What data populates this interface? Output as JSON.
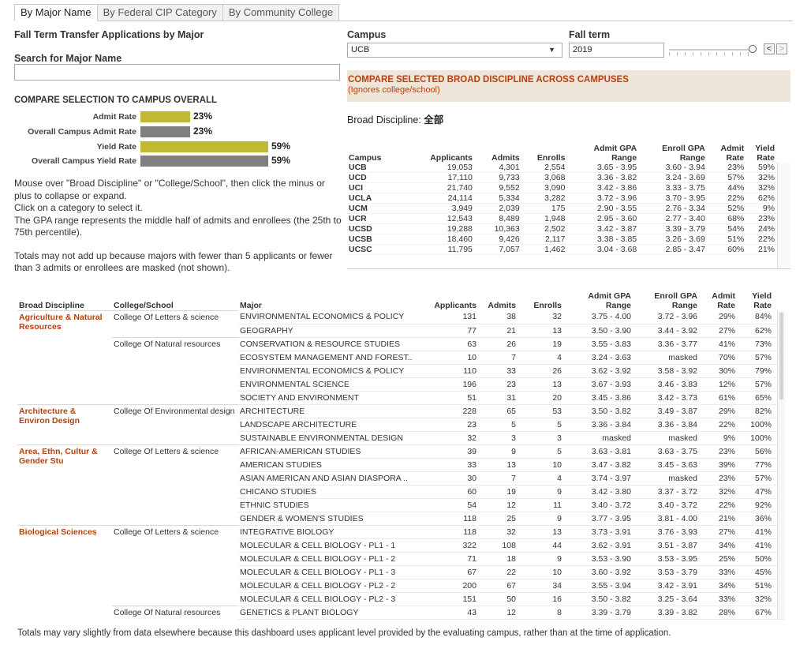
{
  "tabs": [
    "By Major Name",
    "By Federal CIP Category",
    "By Community College"
  ],
  "left": {
    "title": "Fall Term Transfer Applications by Major",
    "search_label": "Search for Major Name",
    "search_value": "",
    "compare_title": "COMPARE SELECTION TO CAMPUS OVERALL",
    "bars": [
      {
        "label": "Admit Rate",
        "value": "23%",
        "fraction": 0.23,
        "color": "#c2b933"
      },
      {
        "label": "Overall Campus Admit Rate",
        "value": "23%",
        "fraction": 0.23,
        "color": "#7f7f7f"
      },
      {
        "label": "Yield Rate",
        "value": "59%",
        "fraction": 0.59,
        "color": "#c2b933"
      },
      {
        "label": "Overall Campus Yield Rate",
        "value": "59%",
        "fraction": 0.59,
        "color": "#7f7f7f"
      }
    ],
    "notes": [
      "Mouse over \"Broad Discipline\" or \"College/School\", then click the minus or plus to collapse or expand.",
      "Click on a category to select it.",
      "The GPA range represents the middle half of admits and enrollees (the 25th to 75th percentile).",
      "Totals may not add up because majors with fewer than 5 applicants or fewer than 3 admits or enrollees are masked (not shown)."
    ]
  },
  "filters": {
    "campus_label": "Campus",
    "campus_value": "UCB",
    "term_label": "Fall term",
    "term_value": "2019",
    "prev_label": "<",
    "next_label": ">"
  },
  "compare_banner": {
    "title": "COMPARE SELECTED BROAD DISCIPLINE ACROSS CAMPUSES",
    "subtitle": "(Ignores college/school)"
  },
  "broad_discipline": {
    "label": "Broad Discipline:",
    "value": "全部"
  },
  "campus_table": {
    "headers": [
      "Campus",
      "Applicants",
      "Admits",
      "Enrolls",
      "Admit GPA Range",
      "Enroll GPA Range",
      "Admit Rate",
      "Yield Rate"
    ],
    "rows": [
      [
        "UCB",
        "19,053",
        "4,301",
        "2,554",
        "3.65 - 3.95",
        "3.60 - 3.94",
        "23%",
        "59%"
      ],
      [
        "UCD",
        "17,110",
        "9,733",
        "3,068",
        "3.36 - 3.82",
        "3.24 - 3.69",
        "57%",
        "32%"
      ],
      [
        "UCI",
        "21,740",
        "9,552",
        "3,090",
        "3.42 - 3.86",
        "3.33 - 3.75",
        "44%",
        "32%"
      ],
      [
        "UCLA",
        "24,114",
        "5,334",
        "3,282",
        "3.72 - 3.96",
        "3.70 - 3.95",
        "22%",
        "62%"
      ],
      [
        "UCM",
        "3,949",
        "2,039",
        "175",
        "2.90 - 3.55",
        "2.76 - 3.34",
        "52%",
        "9%"
      ],
      [
        "UCR",
        "12,543",
        "8,489",
        "1,948",
        "2.95 - 3.60",
        "2.77 - 3.40",
        "68%",
        "23%"
      ],
      [
        "UCSD",
        "19,288",
        "10,363",
        "2,502",
        "3.42 - 3.87",
        "3.39 - 3.79",
        "54%",
        "24%"
      ],
      [
        "UCSB",
        "18,460",
        "9,426",
        "2,117",
        "3.38 - 3.85",
        "3.26 - 3.69",
        "51%",
        "22%"
      ],
      [
        "UCSC",
        "11,795",
        "7,057",
        "1,462",
        "3.04 - 3.68",
        "2.85 - 3.47",
        "60%",
        "21%"
      ]
    ]
  },
  "main_table": {
    "headers": [
      "Broad Discipline",
      "College/School",
      "Major",
      "Applicants",
      "Admits",
      "Enrolls",
      "Admit GPA Range",
      "Enroll GPA Range",
      "Admit Rate",
      "Yield Rate"
    ],
    "groups": [
      {
        "discipline": "Agriculture & Natural Resources",
        "colleges": [
          {
            "name": "College Of Letters & science",
            "rows": [
              [
                "ENVIRONMENTAL ECONOMICS & POLICY",
                "131",
                "38",
                "32",
                "3.75 - 4.00",
                "3.72 - 3.96",
                "29%",
                "84%"
              ],
              [
                "GEOGRAPHY",
                "77",
                "21",
                "13",
                "3.50 - 3.90",
                "3.44 - 3.92",
                "27%",
                "62%"
              ]
            ]
          },
          {
            "name": "College Of Natural resources",
            "rows": [
              [
                "CONSERVATION & RESOURCE STUDIES",
                "63",
                "26",
                "19",
                "3.55 - 3.83",
                "3.36 - 3.77",
                "41%",
                "73%"
              ],
              [
                "ECOSYSTEM MANAGEMENT AND FOREST..",
                "10",
                "7",
                "4",
                "3.24 - 3.63",
                "masked",
                "70%",
                "57%"
              ],
              [
                "ENVIRONMENTAL ECONOMICS & POLICY",
                "110",
                "33",
                "26",
                "3.62 - 3.92",
                "3.58 - 3.92",
                "30%",
                "79%"
              ],
              [
                "ENVIRONMENTAL SCIENCE",
                "196",
                "23",
                "13",
                "3.67 - 3.93",
                "3.46 - 3.83",
                "12%",
                "57%"
              ],
              [
                "SOCIETY AND ENVIRONMENT",
                "51",
                "31",
                "20",
                "3.45 - 3.86",
                "3.42 - 3.73",
                "61%",
                "65%"
              ]
            ]
          }
        ]
      },
      {
        "discipline": "Architecture & Environ Design",
        "colleges": [
          {
            "name": "College Of Environmental design",
            "rows": [
              [
                "ARCHITECTURE",
                "228",
                "65",
                "53",
                "3.50 - 3.82",
                "3.49 - 3.87",
                "29%",
                "82%"
              ],
              [
                "LANDSCAPE ARCHITECTURE",
                "23",
                "5",
                "5",
                "3.36 - 3.84",
                "3.36 - 3.84",
                "22%",
                "100%"
              ],
              [
                "SUSTAINABLE ENVIRONMENTAL DESIGN",
                "32",
                "3",
                "3",
                "masked",
                "masked",
                "9%",
                "100%"
              ]
            ]
          }
        ]
      },
      {
        "discipline": "Area, Ethn, Cultur & Gender Stu",
        "colleges": [
          {
            "name": "College Of Letters & science",
            "rows": [
              [
                "AFRICAN-AMERICAN STUDIES",
                "39",
                "9",
                "5",
                "3.63 - 3.81",
                "3.63 - 3.75",
                "23%",
                "56%"
              ],
              [
                "AMERICAN STUDIES",
                "33",
                "13",
                "10",
                "3.47 - 3.82",
                "3.45 - 3.63",
                "39%",
                "77%"
              ],
              [
                "ASIAN AMERICAN AND ASIAN DIASPORA ..",
                "30",
                "7",
                "4",
                "3.74 - 3.97",
                "masked",
                "23%",
                "57%"
              ],
              [
                "CHICANO STUDIES",
                "60",
                "19",
                "9",
                "3.42 - 3.80",
                "3.37 - 3.72",
                "32%",
                "47%"
              ],
              [
                "ETHNIC STUDIES",
                "54",
                "12",
                "11",
                "3.40 - 3.72",
                "3.40 - 3.72",
                "22%",
                "92%"
              ],
              [
                "GENDER & WOMEN'S STUDIES",
                "118",
                "25",
                "9",
                "3.77 - 3.95",
                "3.81 - 4.00",
                "21%",
                "36%"
              ]
            ]
          }
        ]
      },
      {
        "discipline": "Biological Sciences",
        "colleges": [
          {
            "name": "College Of Letters & science",
            "rows": [
              [
                "INTEGRATIVE BIOLOGY",
                "118",
                "32",
                "13",
                "3.73 - 3.91",
                "3.76 - 3.93",
                "27%",
                "41%"
              ],
              [
                "MOLECULAR & CELL BIOLOGY - PL1 - 1",
                "322",
                "108",
                "44",
                "3.62 - 3.91",
                "3.51 - 3.87",
                "34%",
                "41%"
              ],
              [
                "MOLECULAR & CELL BIOLOGY - PL1 - 2",
                "71",
                "18",
                "9",
                "3.53 - 3.90",
                "3.53 - 3.95",
                "25%",
                "50%"
              ],
              [
                "MOLECULAR & CELL BIOLOGY - PL1 - 3",
                "67",
                "22",
                "10",
                "3.60 - 3.92",
                "3.53 - 3.79",
                "33%",
                "45%"
              ],
              [
                "MOLECULAR & CELL BIOLOGY - PL2 - 2",
                "200",
                "67",
                "34",
                "3.55 - 3.94",
                "3.42 - 3.91",
                "34%",
                "51%"
              ],
              [
                "MOLECULAR & CELL BIOLOGY - PL2 - 3",
                "151",
                "50",
                "16",
                "3.50 - 3.82",
                "3.25 - 3.64",
                "33%",
                "32%"
              ]
            ]
          },
          {
            "name": "College Of Natural resources",
            "rows": [
              [
                "GENETICS & PLANT BIOLOGY",
                "43",
                "12",
                "8",
                "3.39 - 3.79",
                "3.39 - 3.82",
                "28%",
                "67%"
              ]
            ]
          }
        ]
      }
    ]
  },
  "footer": "Totals may vary slightly from data elsewhere because this dashboard uses applicant level provided by the evaluating campus, rather than at the time of application."
}
